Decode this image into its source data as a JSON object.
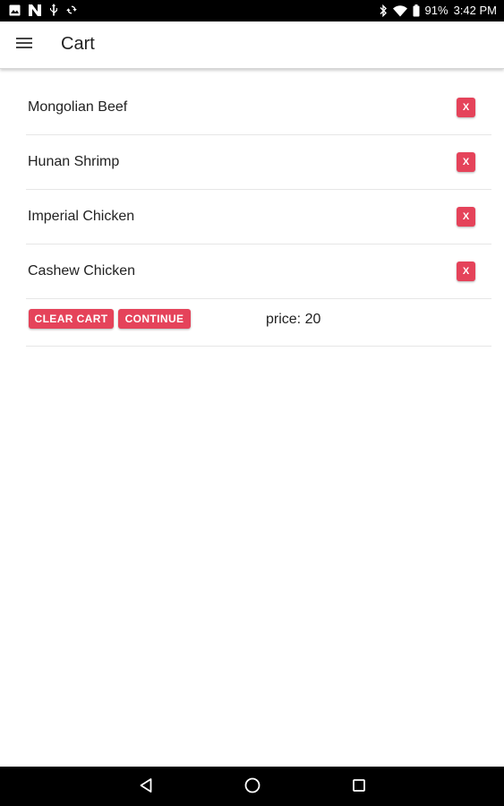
{
  "status_bar": {
    "battery_percent": "91%",
    "time": "3:42 PM",
    "left_icons": [
      "image-icon",
      "n-notification-icon",
      "usb-icon",
      "sync-icon"
    ],
    "right_icons": [
      "bluetooth-icon",
      "wifi-icon",
      "battery-icon"
    ]
  },
  "app_bar": {
    "title": "Cart",
    "menu_icon": "hamburger-menu-icon"
  },
  "cart": {
    "items": [
      {
        "name": "Mongolian Beef",
        "remove_label": "X"
      },
      {
        "name": "Hunan Shrimp",
        "remove_label": "X"
      },
      {
        "name": "Imperial Chicken",
        "remove_label": "X"
      },
      {
        "name": "Cashew Chicken",
        "remove_label": "X"
      }
    ],
    "clear_label": "CLEAR CART",
    "continue_label": "CONTINUE",
    "price_text": "price: 20"
  },
  "nav_bar": {
    "icons": [
      "back-icon",
      "home-icon",
      "recents-icon"
    ]
  },
  "colors": {
    "accent": "#e5435a",
    "status_bar": "#000000",
    "nav_bar": "#000000",
    "text": "#222222"
  }
}
